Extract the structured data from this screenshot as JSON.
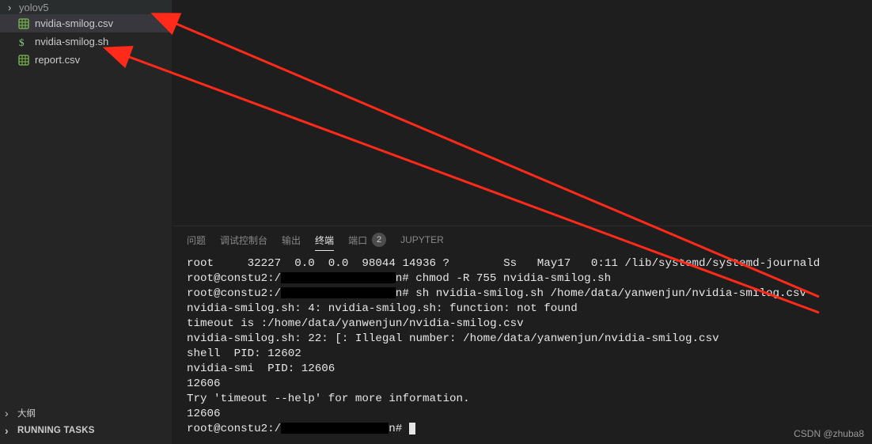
{
  "sidebar": {
    "files": [
      {
        "label": "yolov5",
        "icon": "chev",
        "kind": "folder"
      },
      {
        "label": "nvidia-smilog.csv",
        "icon": "csv",
        "selected": true
      },
      {
        "label": "nvidia-smilog.sh",
        "icon": "sh",
        "selected": false
      },
      {
        "label": "report.csv",
        "icon": "csv",
        "selected": false
      }
    ],
    "sections": [
      {
        "label": "大纲",
        "bold": false
      },
      {
        "label": "RUNNING TASKS",
        "bold": true
      }
    ]
  },
  "panel": {
    "tabs": [
      {
        "label": "问题",
        "active": false
      },
      {
        "label": "调试控制台",
        "active": false
      },
      {
        "label": "输出",
        "active": false
      },
      {
        "label": "终端",
        "active": true
      },
      {
        "label": "端口",
        "active": false,
        "badge": "2"
      },
      {
        "label": "JUPYTER",
        "active": false
      }
    ],
    "terminal_lines": [
      "root     32227  0.0  0.0  98044 14936 ?        Ss   May17   0:11 /lib/systemd/systemd-journald",
      "root@constu2:/█████████████████n# chmod -R 755 nvidia-smilog.sh",
      "root@constu2:/█████████████████n# sh nvidia-smilog.sh /home/data/yanwenjun/nvidia-smilog.csv",
      "nvidia-smilog.sh: 4: nvidia-smilog.sh: function: not found",
      "timeout is :/home/data/yanwenjun/nvidia-smilog.csv",
      "nvidia-smilog.sh: 22: [: Illegal number: /home/data/yanwenjun/nvidia-smilog.csv",
      "shell  PID: 12602",
      "nvidia-smi  PID: 12606",
      "12606",
      "Try 'timeout --help' for more information.",
      "12606",
      "root@constu2:/████████████████n# ▮"
    ]
  },
  "watermark": "CSDN @zhuba8"
}
